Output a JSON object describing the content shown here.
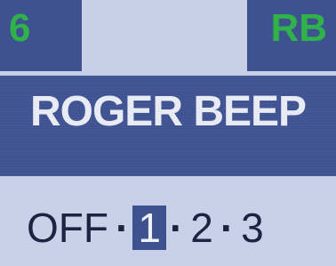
{
  "header": {
    "channel_number": "6",
    "mode_code": "RB"
  },
  "menu": {
    "title": "ROGER BEEP"
  },
  "options": {
    "items": [
      "OFF",
      "1",
      "2",
      "3"
    ],
    "separator": "·",
    "selected": "1"
  },
  "colors": {
    "status_text": "#2fb24a",
    "band": "#3e5290",
    "light_bg": "#c8d0e8",
    "option_text": "#1b2440"
  }
}
